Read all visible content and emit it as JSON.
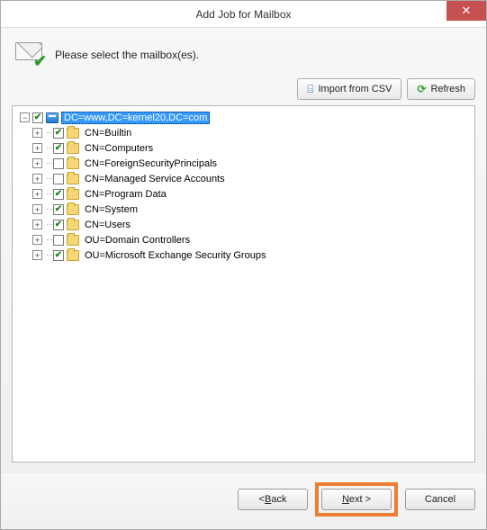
{
  "window": {
    "title": "Add Job for Mailbox",
    "close_glyph": "✕"
  },
  "instruction": "Please select the mailbox(es).",
  "toolbar": {
    "import_label": "Import from CSV",
    "refresh_label": "Refresh"
  },
  "tree": {
    "root": {
      "label": "DC=www,DC=kernel20,DC=com",
      "checked": true,
      "selected": true,
      "expanded": true
    },
    "children": [
      {
        "label": "CN=Builtin",
        "checked": true
      },
      {
        "label": "CN=Computers",
        "checked": true
      },
      {
        "label": "CN=ForeignSecurityPrincipals",
        "checked": false
      },
      {
        "label": "CN=Managed Service Accounts",
        "checked": false
      },
      {
        "label": "CN=Program Data",
        "checked": true
      },
      {
        "label": "CN=System",
        "checked": true
      },
      {
        "label": "CN=Users",
        "checked": true
      },
      {
        "label": "OU=Domain Controllers",
        "checked": false
      },
      {
        "label": "OU=Microsoft Exchange Security Groups",
        "checked": true
      }
    ]
  },
  "buttons": {
    "back_prefix": "< ",
    "back_u": "B",
    "back_rest": "ack",
    "next_u": "N",
    "next_rest": "ext >",
    "cancel": "Cancel"
  }
}
